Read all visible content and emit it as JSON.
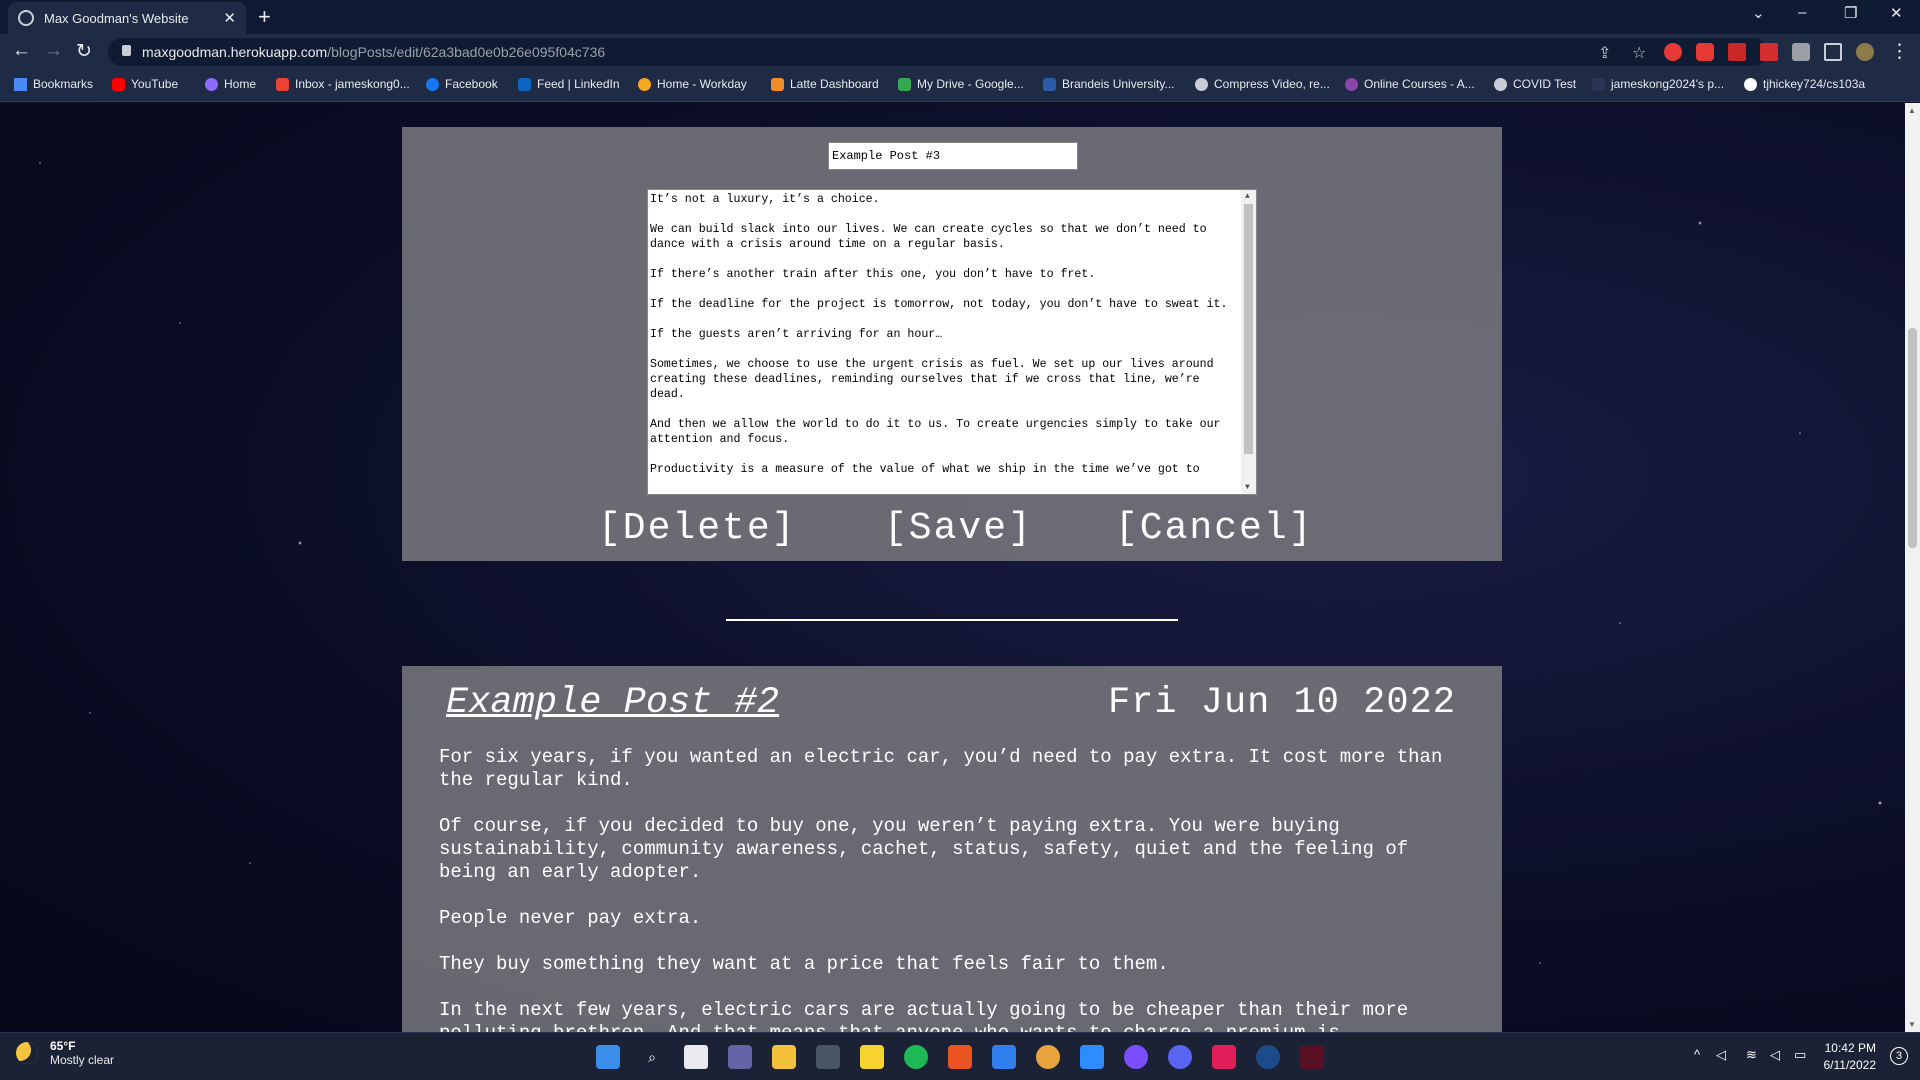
{
  "browser": {
    "tab_title": "Max Goodman's Website",
    "tab_close": "✕",
    "new_tab": "+",
    "url_host": "maxgoodman.herokuapp.com",
    "url_path": "/blogPosts/edit/62a3bad0e0b26e095f04c736"
  },
  "bookmarks": [
    {
      "label": "Bookmarks",
      "icon": "star-icon",
      "color": "#4a8af4"
    },
    {
      "label": "YouTube",
      "icon": "youtube-icon",
      "color": "#ff0000"
    },
    {
      "label": "Home",
      "icon": "moon-icon",
      "color": "#8e6bff"
    },
    {
      "label": "Inbox - jameskong0...",
      "icon": "gmail-icon",
      "color": "#ea4335"
    },
    {
      "label": "Facebook",
      "icon": "facebook-icon",
      "color": "#1877f2"
    },
    {
      "label": "Feed | LinkedIn",
      "icon": "linkedin-icon",
      "color": "#0a66c2"
    },
    {
      "label": "Home - Workday",
      "icon": "workday-icon",
      "color": "#f5a623"
    },
    {
      "label": "Latte Dashboard",
      "icon": "latte-icon",
      "color": "#f28c28"
    },
    {
      "label": "My Drive - Google...",
      "icon": "drive-icon",
      "color": "#34a853"
    },
    {
      "label": "Brandeis University...",
      "icon": "brandeis-icon",
      "color": "#2a5caa"
    },
    {
      "label": "Compress Video, re...",
      "icon": "compress-icon",
      "color": "#c9cdd6"
    },
    {
      "label": "Online Courses - A...",
      "icon": "courses-icon",
      "color": "#8e44ad"
    },
    {
      "label": "COVID Test",
      "icon": "globe-icon",
      "color": "#c9cdd6"
    },
    {
      "label": "jameskong2024's p...",
      "icon": "page-icon",
      "color": "#2a3554"
    },
    {
      "label": "tjhickey724/cs103a",
      "icon": "github-icon",
      "color": "#ffffff"
    }
  ],
  "editor": {
    "title_value": "Example Post #3",
    "body_paragraphs": [
      "It’s not a luxury, it’s a choice.",
      "We can build slack into our lives. We can create cycles so that we don’t need to dance with a crisis around time on a regular basis.",
      "If there’s another train after this one, you don’t have to fret.",
      "If the deadline for the project is tomorrow, not today, you don’t have to sweat it.",
      "If the guests aren’t arriving for an hour…",
      "Sometimes, we choose to use the urgent crisis as fuel. We set up our lives around creating these deadlines, reminding ourselves that if we cross that line, we’re dead.",
      "And then we allow the world to do it to us. To create urgencies simply to take our attention and focus.",
      "Productivity is a measure of the value of what we ship in the time we’ve got to"
    ],
    "delete_label": "[Delete]",
    "save_label": "[Save]",
    "cancel_label": "[Cancel]"
  },
  "post": {
    "title": "Example Post #2",
    "date": "Fri Jun 10 2022",
    "paragraphs": [
      "For six years, if you wanted an electric car, you’d need to pay extra. It cost more than the regular kind.",
      "Of course, if you decided to buy one, you weren’t paying extra. You were buying sustainability, community awareness, cachet, status, safety, quiet and the feeling of being an early adopter.",
      "People never pay extra.",
      "They buy something they want at a price that feels fair to them.",
      "In the next few years, electric cars are actually going to be cheaper than their more polluting brethren. And that means that anyone who wants to charge a premium is"
    ]
  },
  "taskbar": {
    "temperature": "65°F",
    "condition": "Mostly clear",
    "time": "10:42 PM",
    "date": "6/11/2022",
    "notifications": "3"
  }
}
